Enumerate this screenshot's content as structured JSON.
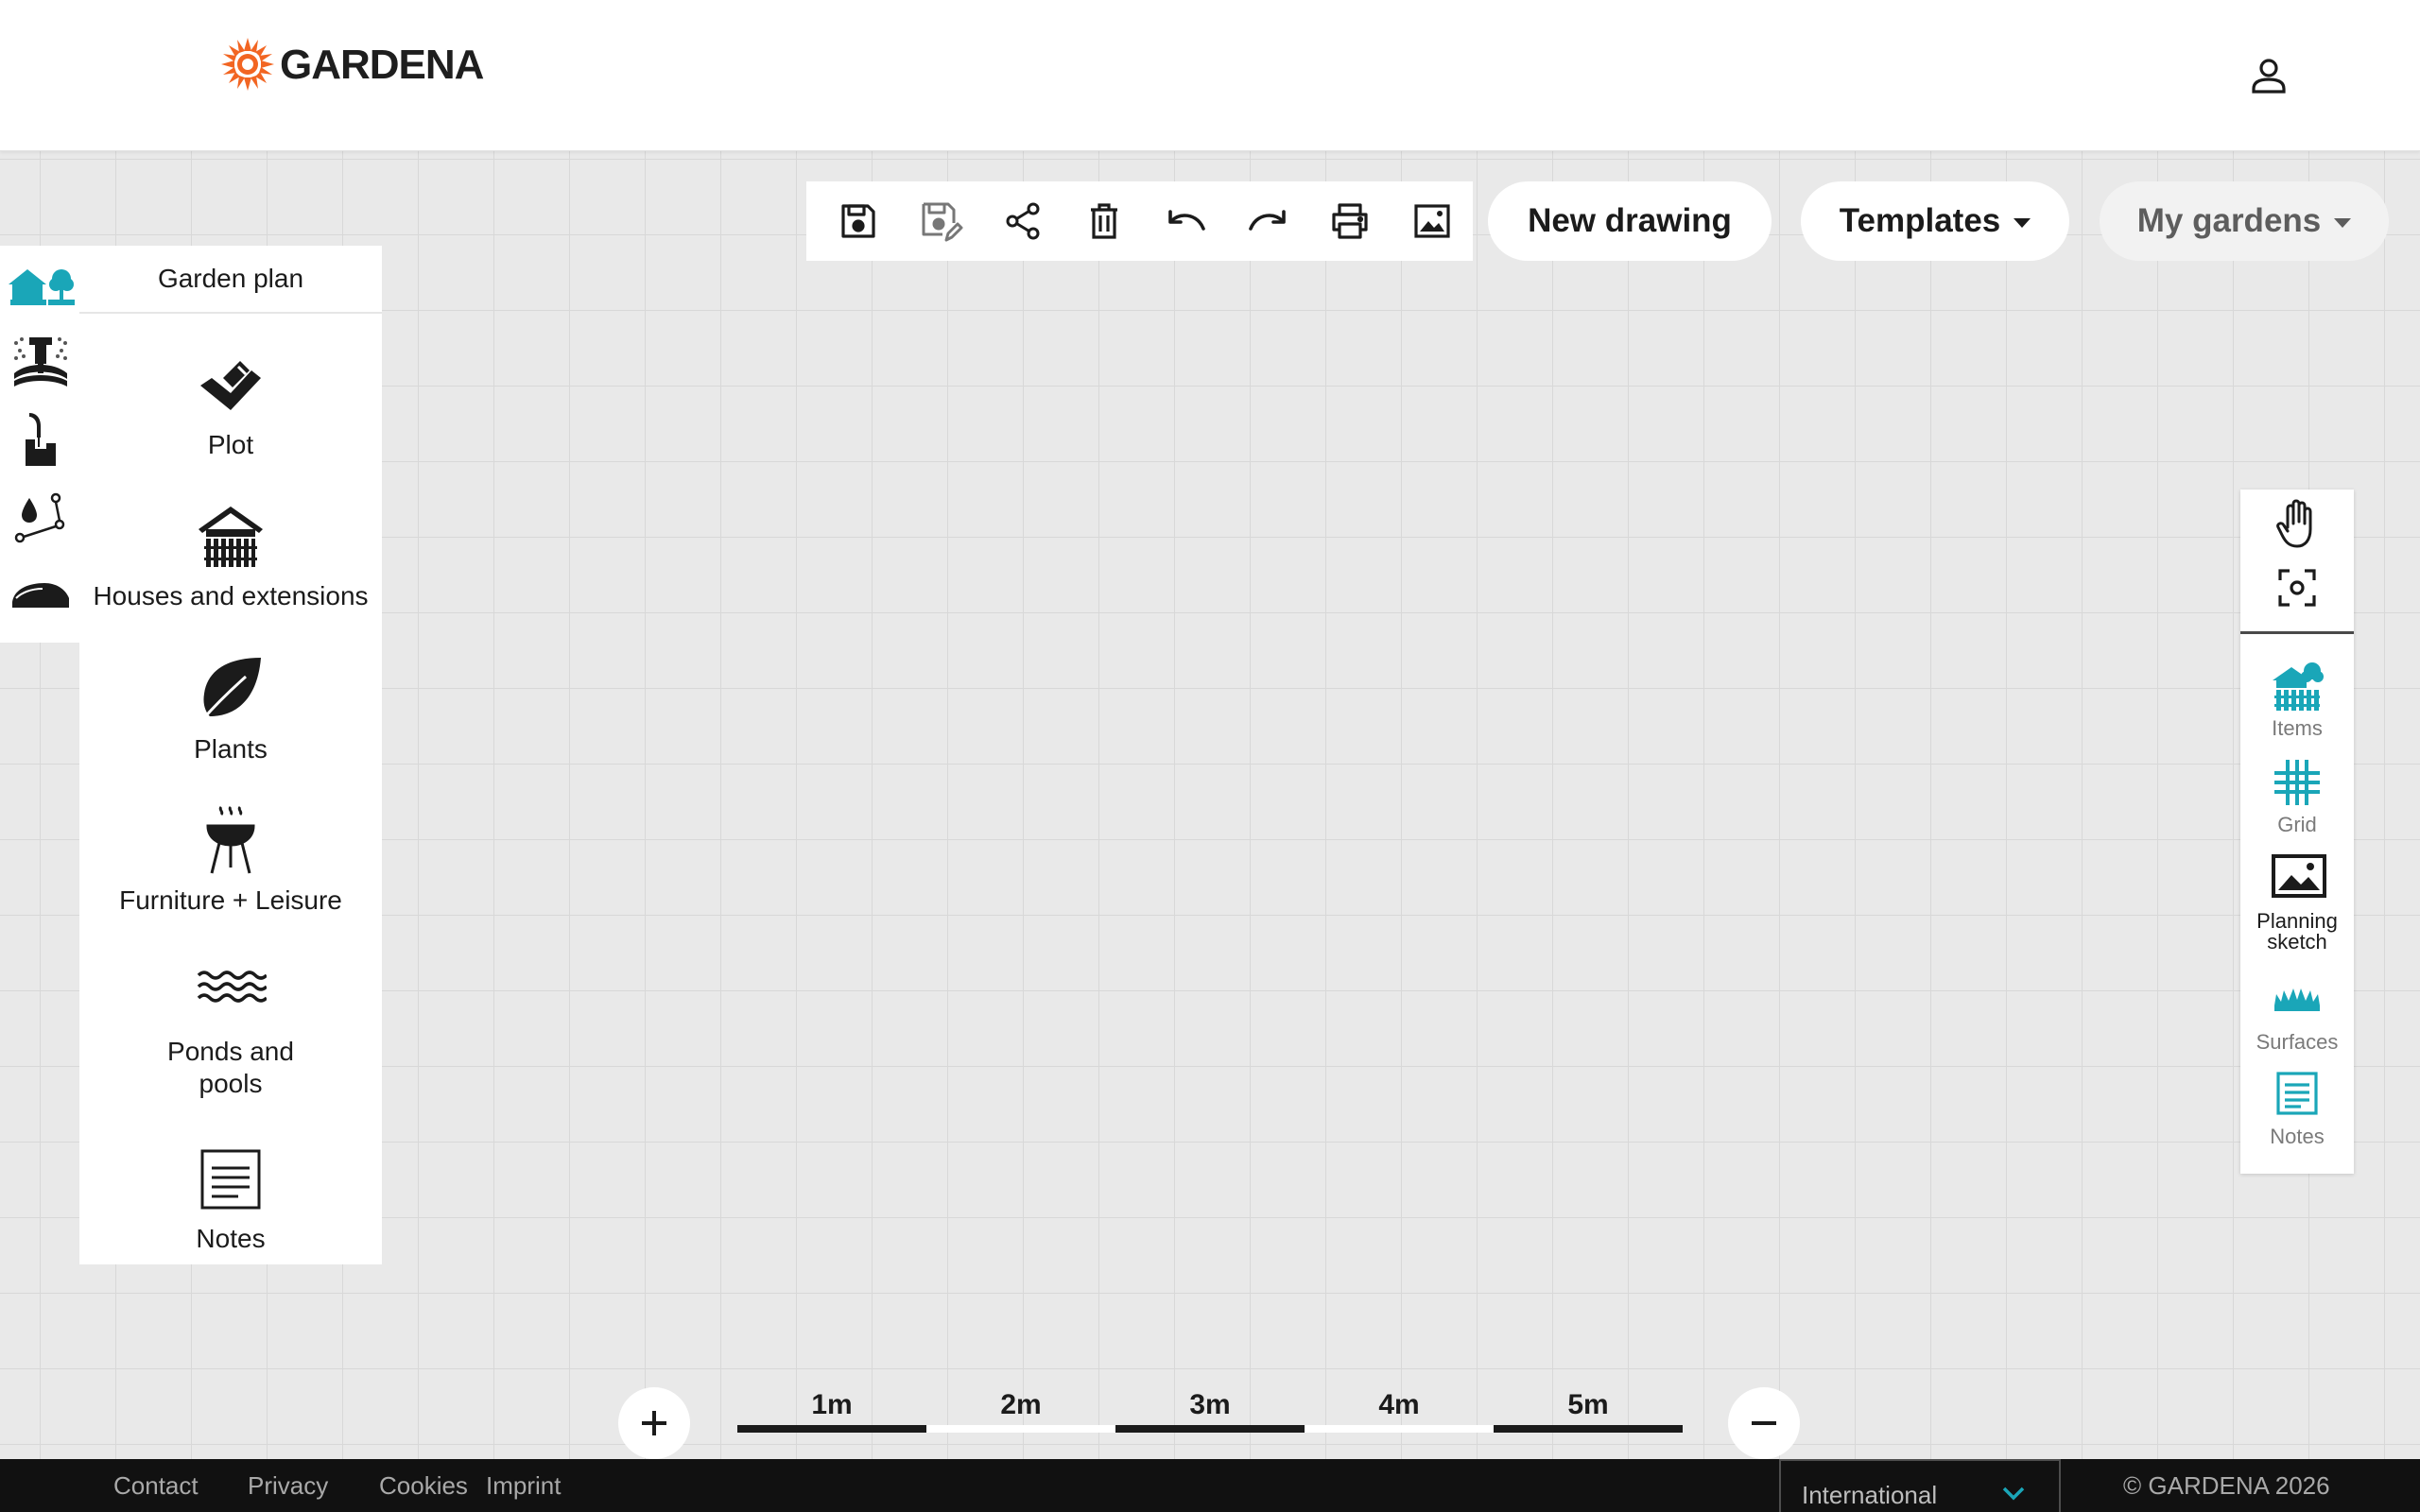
{
  "header": {
    "brand": "GARDENA",
    "user_icon": "user-icon"
  },
  "toolbar": {
    "tools": [
      {
        "icon": "save-icon"
      },
      {
        "icon": "save-as-icon"
      },
      {
        "icon": "share-icon"
      },
      {
        "icon": "trash-icon"
      },
      {
        "icon": "undo-icon"
      },
      {
        "icon": "redo-icon"
      },
      {
        "icon": "print-icon"
      },
      {
        "icon": "image-export-icon"
      }
    ],
    "new_drawing": "New drawing",
    "templates": "Templates",
    "my_gardens": "My gardens"
  },
  "categories": [
    {
      "icon": "garden-plan-icon",
      "active": true
    },
    {
      "icon": "sprinkler-icon",
      "active": false
    },
    {
      "icon": "tap-icon",
      "active": false
    },
    {
      "icon": "drip-irrigation-icon",
      "active": false
    },
    {
      "icon": "robotic-mower-icon",
      "active": false
    }
  ],
  "panel": {
    "title": "Garden plan",
    "items": [
      {
        "label": "Plot",
        "icon": "plot-icon"
      },
      {
        "label": "Houses and extensions",
        "icon": "house-icon"
      },
      {
        "label": "Plants",
        "icon": "leaf-icon"
      },
      {
        "label": "Furniture + Leisure",
        "icon": "grill-icon"
      },
      {
        "label": "Ponds and pools",
        "icon": "waves-icon"
      },
      {
        "label": "Notes",
        "icon": "note-icon"
      }
    ]
  },
  "right_panel": {
    "tools": [
      {
        "icon": "hand-icon"
      },
      {
        "icon": "focus-icon"
      }
    ],
    "items": [
      {
        "label": "Items",
        "icon": "items-icon"
      },
      {
        "label": "Grid",
        "icon": "grid-icon"
      },
      {
        "label": "Planning sketch",
        "icon": "picture-icon"
      },
      {
        "label": "Surfaces",
        "icon": "grass-icon"
      },
      {
        "label": "Notes",
        "icon": "note-icon"
      }
    ]
  },
  "scale": {
    "labels": [
      "1m",
      "2m",
      "3m",
      "4m",
      "5m"
    ]
  },
  "zoom": {
    "in_icon": "plus-icon",
    "out_icon": "minus-icon"
  },
  "footer": {
    "links": [
      "Contact",
      "Privacy",
      "Cookies",
      "Imprint"
    ],
    "region": "International",
    "copyright": "© GARDENA 2026"
  },
  "colors": {
    "accent": "#1aa6b8",
    "brand_orange": "#f26522",
    "canvas": "#e9e9e9",
    "footer": "#111111"
  }
}
